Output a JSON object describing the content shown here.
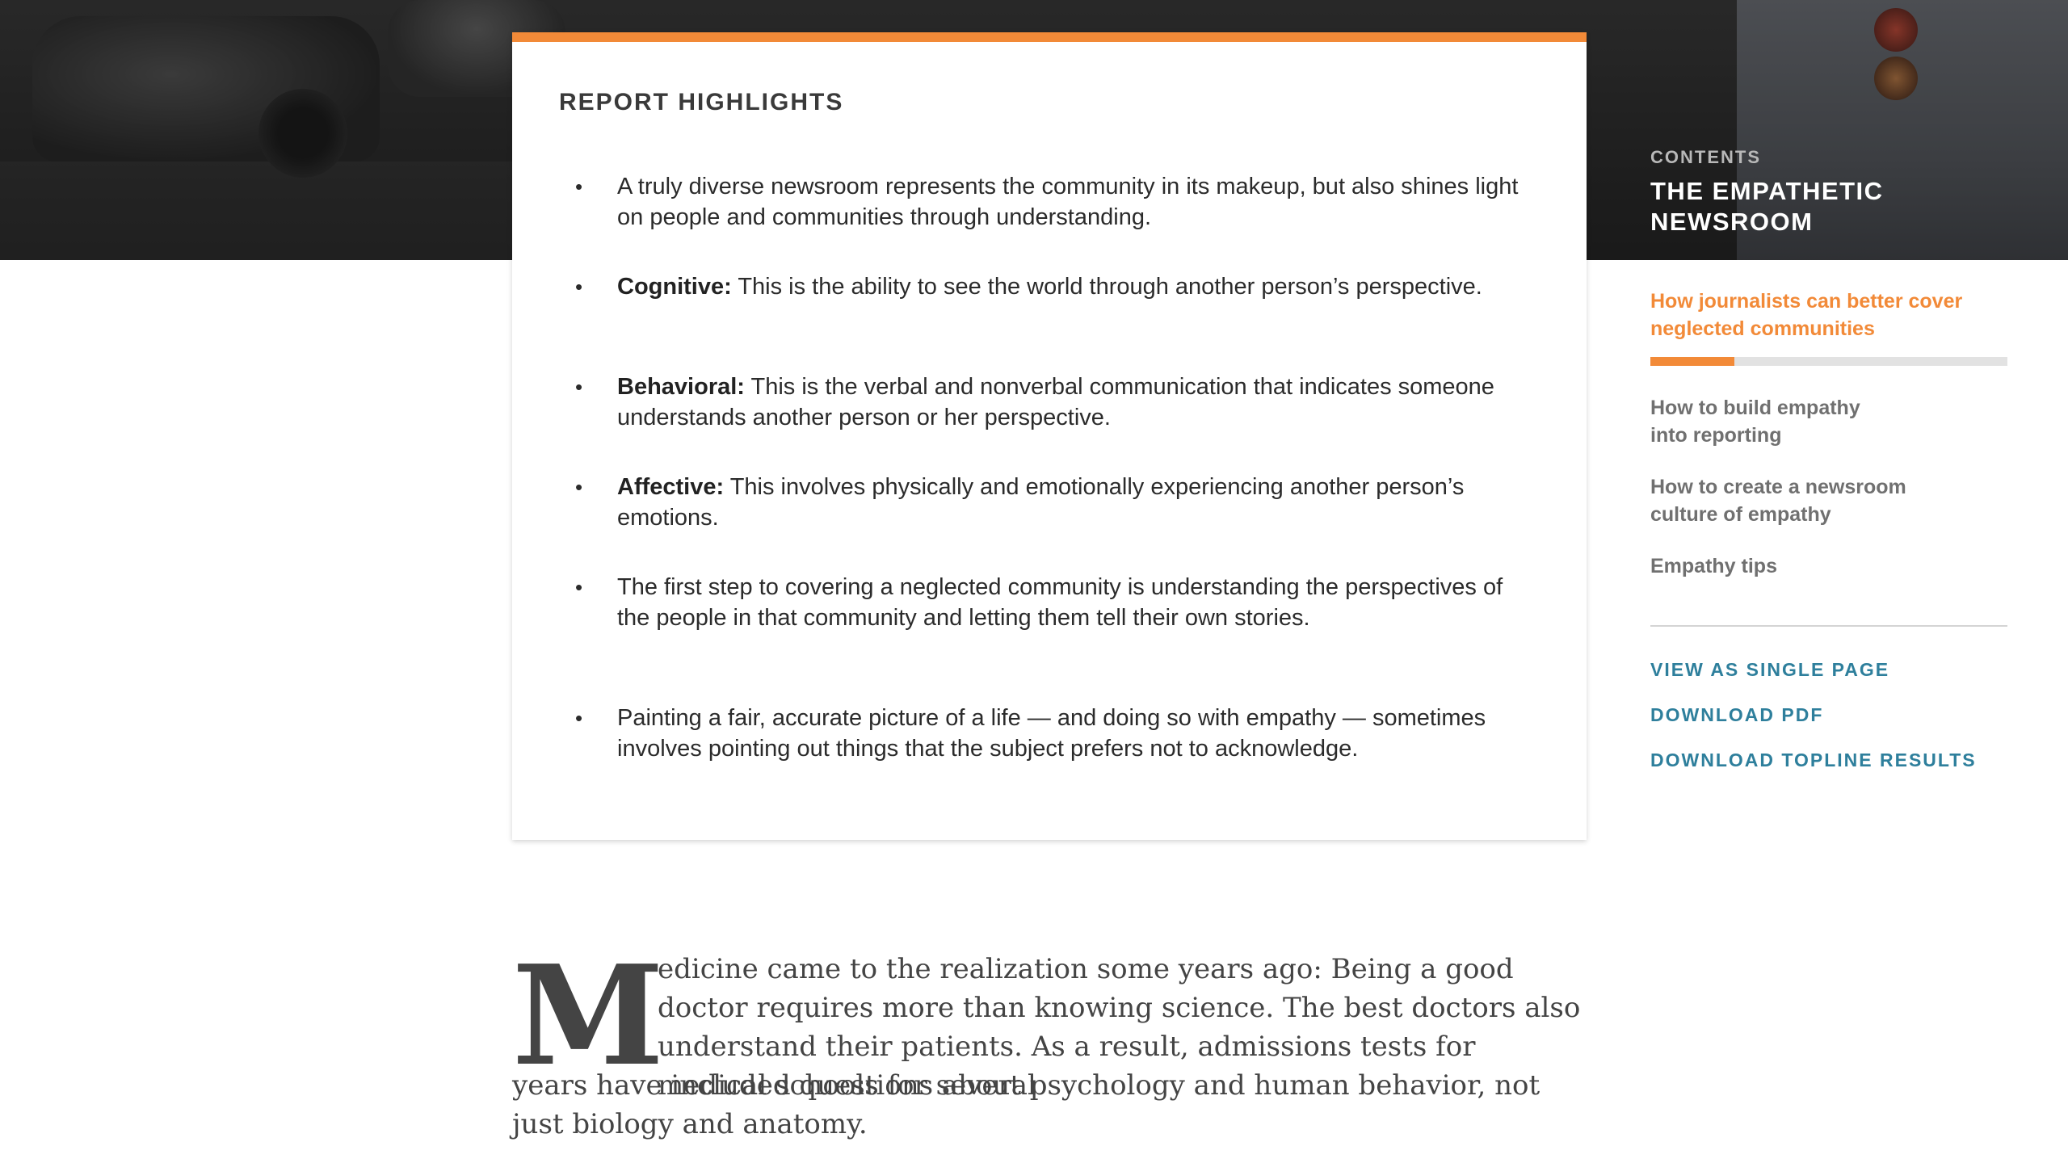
{
  "highlights": {
    "title": "REPORT HIGHLIGHTS",
    "bullet_glyph": "•",
    "items": [
      {
        "bold": "",
        "text": "A truly diverse newsroom represents the community in its makeup, but also shines light on people and communities through understanding."
      },
      {
        "bold": "Cognitive:",
        "text": " This is the ability to see the world through another person’s perspective."
      },
      {
        "bold": "Behavioral:",
        "text": " This is the verbal and nonverbal communication that indicates someone understands another person or her perspective."
      },
      {
        "bold": "Affective:",
        "text": " This involves physically and emotionally experiencing another person’s emotions."
      },
      {
        "bold": "",
        "text": "The first step to covering a neglected community is understanding the perspectives of the people in that community and letting them tell their own stories."
      },
      {
        "bold": "",
        "text": "Painting a fair, accurate picture of a life — and doing so with empathy — sometimes involves pointing out things that the subject prefers not to acknowledge."
      }
    ]
  },
  "sidebar": {
    "contents_label": "CONTENTS",
    "title": "THE EMPATHETIC NEWSROOM",
    "toc": [
      {
        "label": "How journalists can better cover neglected communities",
        "active": true
      },
      {
        "label": "How to build empathy into reporting",
        "active": false
      },
      {
        "label": "How to create a newsroom culture of empathy",
        "active": false
      },
      {
        "label": "Empathy tips",
        "active": false
      }
    ],
    "reading_progress": 0.235,
    "actions": [
      {
        "label": "VIEW AS SINGLE PAGE"
      },
      {
        "label": "DOWNLOAD PDF"
      },
      {
        "label": "DOWNLOAD TOPLINE RESULTS"
      }
    ]
  },
  "article": {
    "dropcap": "M",
    "line_one": "edicine came to the realization some years ago: Being a good doctor requires more than knowing science. The best doctors also understand their patients. As a result, admissions tests for medical schools for several",
    "line_two": "years have included questions about psychology and human behavior, not just biology and anatomy."
  },
  "colors": {
    "accent": "#f28a38",
    "link": "#2e7f9c",
    "muted_toc": "#707070"
  }
}
